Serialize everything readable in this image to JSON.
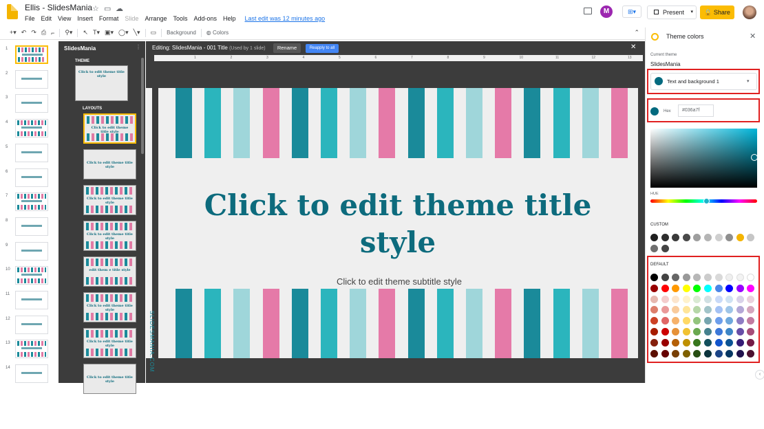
{
  "header": {
    "doc_title": "Ellis - SlidesMania",
    "menus": [
      "File",
      "Edit",
      "View",
      "Insert",
      "Format",
      "Slide",
      "Arrange",
      "Tools",
      "Add-ons",
      "Help"
    ],
    "last_edit": "Last edit was 12 minutes ago",
    "present_label": "Present",
    "share_label": "Share",
    "share_icon": "lock-icon"
  },
  "toolbar": {
    "background_label": "Background",
    "colors_label": "Colors"
  },
  "filmstrip": {
    "slide_numbers": [
      "1",
      "2",
      "3",
      "4",
      "5",
      "6",
      "7",
      "8",
      "9",
      "10",
      "11",
      "12",
      "13",
      "14"
    ]
  },
  "layouts_panel": {
    "title": "SlidesMania",
    "theme_label": "THEME",
    "layouts_label": "LAYOUTS",
    "theme_thumb_text": "Click to edit theme title style",
    "layout_thumbs": [
      "Click to edit theme title style",
      "Click to edit theme title style",
      "Click to edit theme title style",
      "Click to edit theme title style",
      "edit them e title style",
      "Click to edit theme title style",
      "Click to edit theme title style",
      "Click to edit theme title style"
    ]
  },
  "editor": {
    "editing_label": "Editing: SlidesMania - 001 Title",
    "used_by": "(Used by 1 slide)",
    "rename_label": "Rename",
    "reapply_label": "Reapply to all",
    "ruler_numbers": [
      "1",
      "2",
      "3",
      "4",
      "5",
      "6",
      "7",
      "8",
      "9",
      "10",
      "11",
      "12",
      "13"
    ]
  },
  "slide": {
    "title": "Click to edit theme title style",
    "subtitle": "Click to edit theme subtitle style",
    "vertical_text": "SLIDESMANIA.COM",
    "colors": {
      "teal_dark": "#1a8a9a",
      "teal": "#2bb5bd",
      "teal_light": "#9fd6da",
      "pink": "#e57aa8",
      "title": "#0d6b7d"
    }
  },
  "theme_panel": {
    "title": "Theme colors",
    "current_theme_label": "Current theme",
    "current_theme_value": "SlidesMania",
    "dropdown_value": "Text and background 1",
    "hex_label": "Hex",
    "hex_value": "#036a7f",
    "hue_label": "HUE",
    "custom_label": "CUSTOM",
    "default_label": "DEFAULT",
    "custom_colors": [
      "#1f1f1f",
      "#2d2d2d",
      "#3a3a3a",
      "#4a4a4a",
      "#9e9e9e",
      "#b5b5b5",
      "#cfcfcf",
      "#8f8f8f",
      "#f4b400",
      "#c6c6c6",
      "#6f6f6f",
      "#444444"
    ],
    "default_colors": [
      [
        "#000000",
        "#434343",
        "#666666",
        "#999999",
        "#b7b7b7",
        "#cccccc",
        "#d9d9d9",
        "#efefef",
        "#f3f3f3",
        "#ffffff"
      ],
      [
        "#980000",
        "#ff0000",
        "#ff9900",
        "#ffff00",
        "#00ff00",
        "#00ffff",
        "#4a86e8",
        "#0000ff",
        "#9900ff",
        "#ff00ff"
      ],
      [
        "#e6b8af",
        "#f4cccc",
        "#fce5cd",
        "#fff2cc",
        "#d9ead3",
        "#d0e0e3",
        "#c9daf8",
        "#cfe2f3",
        "#d9d2e9",
        "#ead1dc"
      ],
      [
        "#dd7e6b",
        "#ea9999",
        "#f9cb9c",
        "#ffe599",
        "#b6d7a8",
        "#a2c4c9",
        "#a4c2f4",
        "#9fc5e8",
        "#b4a7d6",
        "#d5a6bd"
      ],
      [
        "#cc4125",
        "#e06666",
        "#f6b26b",
        "#ffd966",
        "#93c47d",
        "#76a5af",
        "#6d9eeb",
        "#6fa8dc",
        "#8e7cc3",
        "#c27ba0"
      ],
      [
        "#a61c00",
        "#cc0000",
        "#e69138",
        "#f1c232",
        "#6aa84f",
        "#45818e",
        "#3c78d8",
        "#3d85c6",
        "#674ea7",
        "#a64d79"
      ],
      [
        "#85200c",
        "#990000",
        "#b45f06",
        "#bf9000",
        "#38761d",
        "#134f5c",
        "#1155cc",
        "#0b5394",
        "#351c75",
        "#741b47"
      ],
      [
        "#5b0f00",
        "#660000",
        "#783f04",
        "#7f6000",
        "#274e13",
        "#0c343d",
        "#1c4587",
        "#073763",
        "#20124d",
        "#4c1130"
      ]
    ]
  }
}
